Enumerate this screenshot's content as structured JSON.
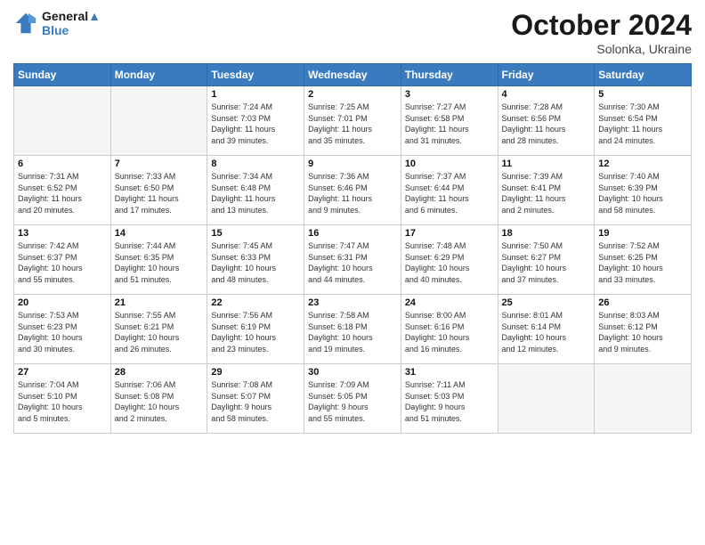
{
  "header": {
    "logo_line1": "General",
    "logo_line2": "Blue",
    "month_title": "October 2024",
    "location": "Solonka, Ukraine"
  },
  "weekdays": [
    "Sunday",
    "Monday",
    "Tuesday",
    "Wednesday",
    "Thursday",
    "Friday",
    "Saturday"
  ],
  "weeks": [
    [
      {
        "day": "",
        "info": ""
      },
      {
        "day": "",
        "info": ""
      },
      {
        "day": "1",
        "info": "Sunrise: 7:24 AM\nSunset: 7:03 PM\nDaylight: 11 hours\nand 39 minutes."
      },
      {
        "day": "2",
        "info": "Sunrise: 7:25 AM\nSunset: 7:01 PM\nDaylight: 11 hours\nand 35 minutes."
      },
      {
        "day": "3",
        "info": "Sunrise: 7:27 AM\nSunset: 6:58 PM\nDaylight: 11 hours\nand 31 minutes."
      },
      {
        "day": "4",
        "info": "Sunrise: 7:28 AM\nSunset: 6:56 PM\nDaylight: 11 hours\nand 28 minutes."
      },
      {
        "day": "5",
        "info": "Sunrise: 7:30 AM\nSunset: 6:54 PM\nDaylight: 11 hours\nand 24 minutes."
      }
    ],
    [
      {
        "day": "6",
        "info": "Sunrise: 7:31 AM\nSunset: 6:52 PM\nDaylight: 11 hours\nand 20 minutes."
      },
      {
        "day": "7",
        "info": "Sunrise: 7:33 AM\nSunset: 6:50 PM\nDaylight: 11 hours\nand 17 minutes."
      },
      {
        "day": "8",
        "info": "Sunrise: 7:34 AM\nSunset: 6:48 PM\nDaylight: 11 hours\nand 13 minutes."
      },
      {
        "day": "9",
        "info": "Sunrise: 7:36 AM\nSunset: 6:46 PM\nDaylight: 11 hours\nand 9 minutes."
      },
      {
        "day": "10",
        "info": "Sunrise: 7:37 AM\nSunset: 6:44 PM\nDaylight: 11 hours\nand 6 minutes."
      },
      {
        "day": "11",
        "info": "Sunrise: 7:39 AM\nSunset: 6:41 PM\nDaylight: 11 hours\nand 2 minutes."
      },
      {
        "day": "12",
        "info": "Sunrise: 7:40 AM\nSunset: 6:39 PM\nDaylight: 10 hours\nand 58 minutes."
      }
    ],
    [
      {
        "day": "13",
        "info": "Sunrise: 7:42 AM\nSunset: 6:37 PM\nDaylight: 10 hours\nand 55 minutes."
      },
      {
        "day": "14",
        "info": "Sunrise: 7:44 AM\nSunset: 6:35 PM\nDaylight: 10 hours\nand 51 minutes."
      },
      {
        "day": "15",
        "info": "Sunrise: 7:45 AM\nSunset: 6:33 PM\nDaylight: 10 hours\nand 48 minutes."
      },
      {
        "day": "16",
        "info": "Sunrise: 7:47 AM\nSunset: 6:31 PM\nDaylight: 10 hours\nand 44 minutes."
      },
      {
        "day": "17",
        "info": "Sunrise: 7:48 AM\nSunset: 6:29 PM\nDaylight: 10 hours\nand 40 minutes."
      },
      {
        "day": "18",
        "info": "Sunrise: 7:50 AM\nSunset: 6:27 PM\nDaylight: 10 hours\nand 37 minutes."
      },
      {
        "day": "19",
        "info": "Sunrise: 7:52 AM\nSunset: 6:25 PM\nDaylight: 10 hours\nand 33 minutes."
      }
    ],
    [
      {
        "day": "20",
        "info": "Sunrise: 7:53 AM\nSunset: 6:23 PM\nDaylight: 10 hours\nand 30 minutes."
      },
      {
        "day": "21",
        "info": "Sunrise: 7:55 AM\nSunset: 6:21 PM\nDaylight: 10 hours\nand 26 minutes."
      },
      {
        "day": "22",
        "info": "Sunrise: 7:56 AM\nSunset: 6:19 PM\nDaylight: 10 hours\nand 23 minutes."
      },
      {
        "day": "23",
        "info": "Sunrise: 7:58 AM\nSunset: 6:18 PM\nDaylight: 10 hours\nand 19 minutes."
      },
      {
        "day": "24",
        "info": "Sunrise: 8:00 AM\nSunset: 6:16 PM\nDaylight: 10 hours\nand 16 minutes."
      },
      {
        "day": "25",
        "info": "Sunrise: 8:01 AM\nSunset: 6:14 PM\nDaylight: 10 hours\nand 12 minutes."
      },
      {
        "day": "26",
        "info": "Sunrise: 8:03 AM\nSunset: 6:12 PM\nDaylight: 10 hours\nand 9 minutes."
      }
    ],
    [
      {
        "day": "27",
        "info": "Sunrise: 7:04 AM\nSunset: 5:10 PM\nDaylight: 10 hours\nand 5 minutes."
      },
      {
        "day": "28",
        "info": "Sunrise: 7:06 AM\nSunset: 5:08 PM\nDaylight: 10 hours\nand 2 minutes."
      },
      {
        "day": "29",
        "info": "Sunrise: 7:08 AM\nSunset: 5:07 PM\nDaylight: 9 hours\nand 58 minutes."
      },
      {
        "day": "30",
        "info": "Sunrise: 7:09 AM\nSunset: 5:05 PM\nDaylight: 9 hours\nand 55 minutes."
      },
      {
        "day": "31",
        "info": "Sunrise: 7:11 AM\nSunset: 5:03 PM\nDaylight: 9 hours\nand 51 minutes."
      },
      {
        "day": "",
        "info": ""
      },
      {
        "day": "",
        "info": ""
      }
    ]
  ]
}
